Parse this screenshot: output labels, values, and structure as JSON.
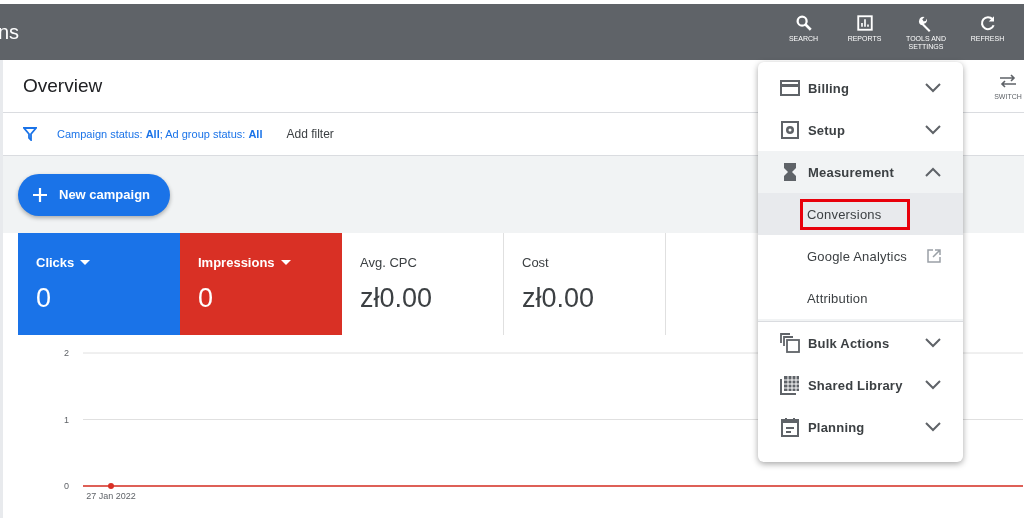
{
  "header": {
    "title_fragment": "ns",
    "actions": [
      {
        "kind": "search",
        "label": "SEARCH"
      },
      {
        "kind": "reports",
        "label": "REPORTS"
      },
      {
        "kind": "tools",
        "label": "TOOLS AND SETTINGS"
      },
      {
        "kind": "refresh",
        "label": "REFRESH"
      }
    ]
  },
  "page": {
    "title": "Overview",
    "switch_view": "SWITCH"
  },
  "filter": {
    "text": "Campaign status: **All**; Ad group status: **All**",
    "add": "Add filter"
  },
  "new_campaign": "New campaign",
  "metrics": [
    {
      "label": "Clicks",
      "value": "0",
      "selected": true,
      "color": "#1a73e8"
    },
    {
      "label": "Impressions",
      "value": "0",
      "selected": true,
      "color": "#d93025"
    },
    {
      "label": "Avg. CPC",
      "value": "zł0.00",
      "selected": false
    },
    {
      "label": "Cost",
      "value": "zł0.00",
      "selected": false
    }
  ],
  "chart": {
    "chart_data": {
      "type": "line",
      "x": [
        "27 Jan 2022"
      ],
      "yticks": [
        0,
        1,
        2
      ],
      "ylim": [
        0,
        2
      ],
      "series": [
        {
          "color": "#d93025",
          "marker": "circle",
          "values": [
            0
          ]
        }
      ]
    }
  },
  "menu": [
    {
      "kind": "billing",
      "label": "Billing",
      "expanded": false
    },
    {
      "kind": "setup",
      "label": "Setup",
      "expanded": false
    },
    {
      "kind": "measurement",
      "label": "Measurement",
      "expanded": true,
      "children": [
        {
          "label": "Conversions",
          "selected": true,
          "outlined": true,
          "external": false
        },
        {
          "label": "Google Analytics",
          "selected": false,
          "outlined": false,
          "external": true
        },
        {
          "label": "Attribution",
          "selected": false,
          "outlined": false,
          "external": false
        }
      ]
    },
    {
      "kind": "bulk",
      "label": "Bulk Actions",
      "expanded": false
    },
    {
      "kind": "library",
      "label": "Shared Library",
      "expanded": false
    },
    {
      "kind": "planning",
      "label": "Planning",
      "expanded": false
    }
  ]
}
